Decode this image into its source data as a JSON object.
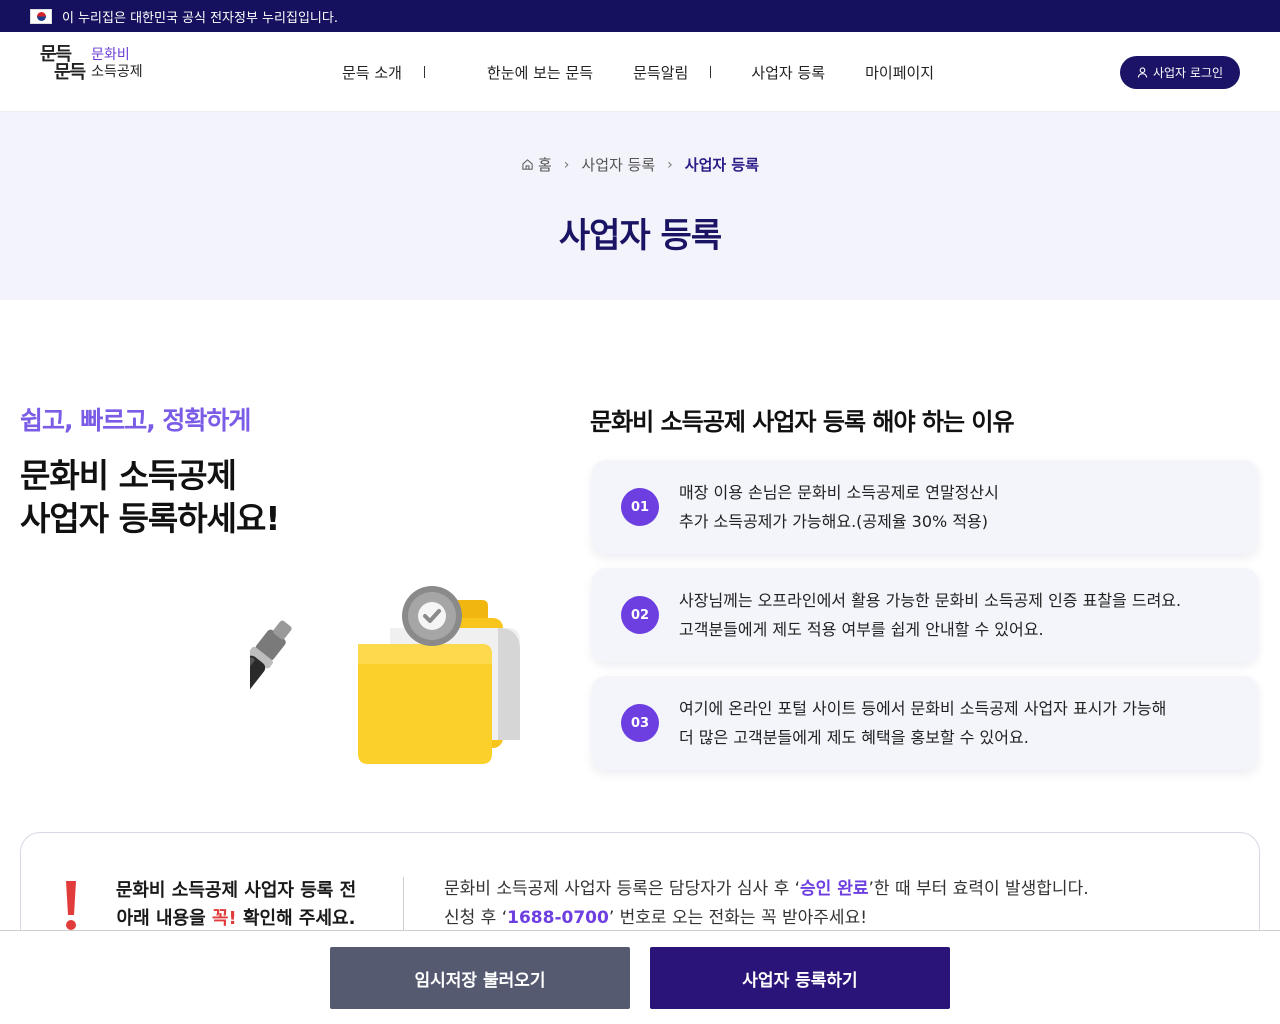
{
  "gov_banner": {
    "text": "이 누리집은 대한민국 공식 전자정부 누리집입니다."
  },
  "logo": {
    "mark_line1": "문득",
    "mark_line2": "문득",
    "text_line1": "문화비",
    "text_line2": "소득공제"
  },
  "nav": {
    "items": [
      "문득 소개",
      "한눈에 보는 문득",
      "문득알림",
      "사업자 등록",
      "마이페이지"
    ]
  },
  "login_button": {
    "label": "사업자 로그인"
  },
  "breadcrumb": {
    "home": "홈",
    "parent": "사업자 등록",
    "current": "사업자 등록"
  },
  "page_title": "사업자 등록",
  "intro": {
    "tagline": "쉽고, 빠르고, 정확하게",
    "headline_line1": "문화비 소득공제",
    "headline_line2": "사업자 등록하세요!"
  },
  "reasons": {
    "title": "문화비 소득공제 사업자 등록 해야 하는 이유",
    "items": [
      {
        "num": "01",
        "line1": "매장 이용 손님은 문화비 소득공제로 연말정산시",
        "line2": "추가 소득공제가 가능해요.(공제율 30% 적용)"
      },
      {
        "num": "02",
        "line1": "사장님께는 오프라인에서 활용 가능한 문화비 소득공제 인증 표찰을 드려요.",
        "line2": "고객분들에게 제도 적용 여부를 쉽게 안내할 수 있어요."
      },
      {
        "num": "03",
        "line1": "여기에 온라인 포털 사이트 등에서 문화비 소득공제 사업자 표시가 가능해",
        "line2": "더 많은 고객분들에게 제도 혜택을 홍보할 수 있어요."
      }
    ]
  },
  "notice": {
    "left_line1": "문화비 소득공제 사업자 등록 전",
    "left_line2_pre": "아래 내용을 ",
    "left_line2_emph": "꼭!",
    "left_line2_post": " 확인해 주세요.",
    "right_line1_pre": "문화비 소득공제 사업자 등록은 담당자가 심사 후 ‘",
    "right_line1_hl": "승인 완료",
    "right_line1_post": "’한 때 부터 효력이 발생합니다.",
    "right_line2_pre": "신청 후 ‘",
    "right_line2_hl": "1688-0700",
    "right_line2_post": "’ 번호로 오는 전화는 꼭 받아주세요!"
  },
  "actions": {
    "load_label": "임시저장 불러오기",
    "submit_label": "사업자 등록하기"
  },
  "colors": {
    "navy": "#15115e",
    "accent_purple": "#6d3fe0",
    "tagline_purple": "#7b5ce6",
    "alert_red": "#e23b3b"
  },
  "icons": [
    "taegukgi-flag-icon",
    "user-icon",
    "home-icon",
    "chevron-right-icon",
    "pen-icon",
    "folder-icon",
    "check-badge-icon",
    "exclamation-icon"
  ]
}
